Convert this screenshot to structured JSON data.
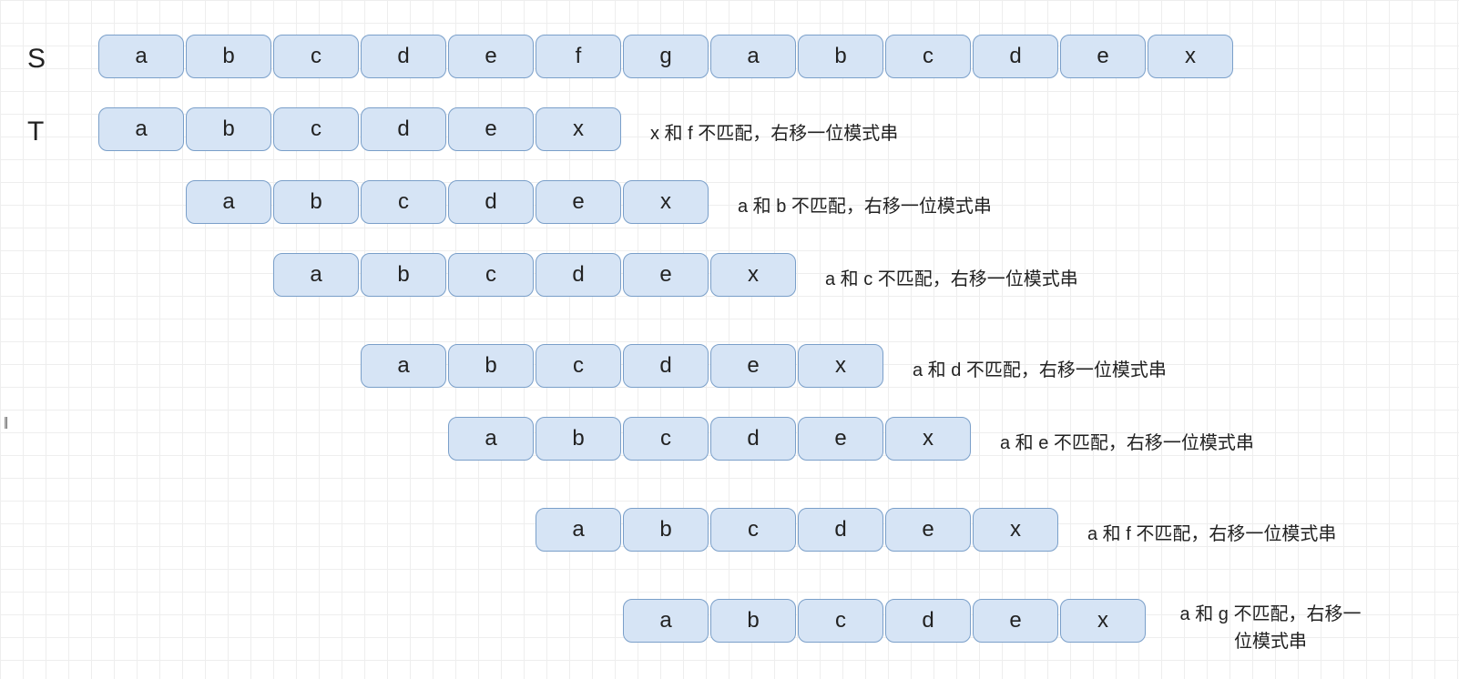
{
  "labels": {
    "s": "S",
    "t": "T"
  },
  "s_chars": [
    "a",
    "b",
    "c",
    "d",
    "e",
    "f",
    "g",
    "a",
    "b",
    "c",
    "d",
    "e",
    "x"
  ],
  "t_chars": [
    "a",
    "b",
    "c",
    "d",
    "e",
    "x"
  ],
  "rows": [
    {
      "offset": 0,
      "annotation": "x 和 f 不匹配，右移一位模式串"
    },
    {
      "offset": 1,
      "annotation": "a 和 b 不匹配，右移一位模式串"
    },
    {
      "offset": 2,
      "annotation": "a 和 c 不匹配，右移一位模式串"
    },
    {
      "offset": 3,
      "annotation": "a 和 d 不匹配，右移一位模式串"
    },
    {
      "offset": 4,
      "annotation": "a 和 e 不匹配，右移一位模式串"
    },
    {
      "offset": 5,
      "annotation": "a 和 f 不匹配，右移一位模式串"
    },
    {
      "offset": 6,
      "annotation": "a 和 g 不匹配，右移一位模式串"
    }
  ],
  "handle": "||"
}
